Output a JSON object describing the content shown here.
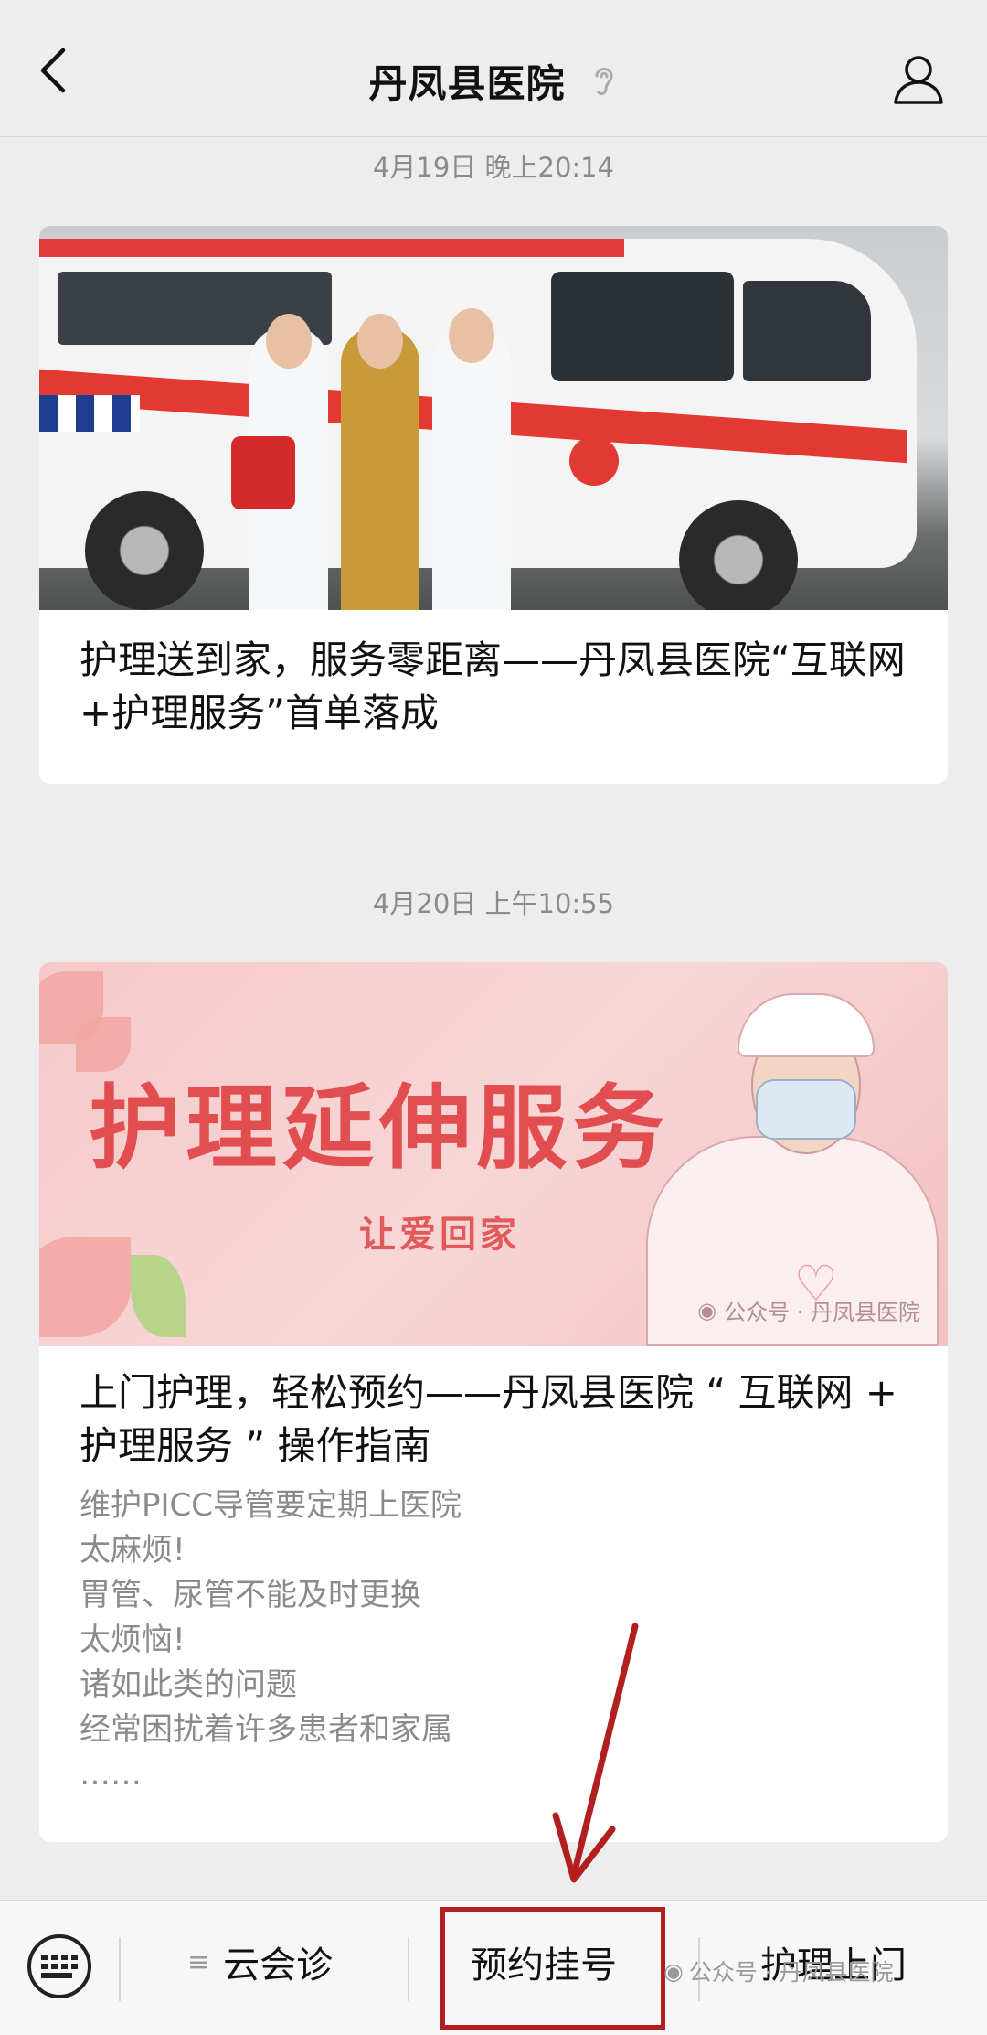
{
  "header": {
    "title": "丹凤县医院",
    "back_icon": "chevron-left-icon",
    "ear_icon": "ear-icon",
    "profile_icon": "person-icon"
  },
  "messages": [
    {
      "timestamp": "4月19日 晚上20:14",
      "image_alt": "ambulance-nurses-photo",
      "title": "护理送到家，服务零距离——丹凤县医院“互联网+护理服务”首单落成"
    },
    {
      "timestamp": "4月20日 上午10:55",
      "banner": {
        "headline": "护理延伸服务",
        "subline": "让爱回家",
        "watermark": "公众号 · 丹凤县医院"
      },
      "title": "上门护理，轻松预约——丹凤县医院 “ 互联网 + 护理服务 ” 操作指南",
      "description": [
        "维护PICC导管要定期上医院",
        "太麻烦!",
        "胃管、尿管不能及时更换",
        "太烦恼!",
        "诸如此类的问题",
        "经常困扰着许多患者和家属",
        "……"
      ]
    }
  ],
  "bottom_menu": {
    "keyboard_icon": "keyboard-icon",
    "items": [
      {
        "label": "云会诊",
        "icon": "menu-icon"
      },
      {
        "label": "预约挂号"
      },
      {
        "label": "护理上门"
      }
    ],
    "watermark": "公众号 · 丹凤县医院"
  },
  "colors": {
    "background": "#ededed",
    "highlight_box": "#b31f1f",
    "arrow": "#b31f1f",
    "banner_text": "#e24d50"
  }
}
